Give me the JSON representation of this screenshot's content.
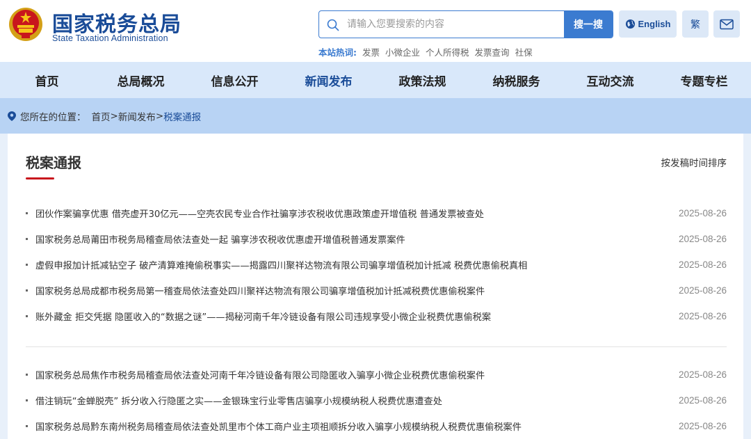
{
  "header": {
    "site_name_cn": "国家税务总局",
    "site_name_en": "State Taxation Administration",
    "search": {
      "placeholder": "请输入您要搜索的内容",
      "button_label": "搜一搜"
    },
    "english_label": "English",
    "traditional_label": "繁",
    "hot_search": {
      "label": "本站热词:",
      "terms": [
        "发票",
        "小微企业",
        "个人所得税",
        "发票查询",
        "社保"
      ]
    }
  },
  "nav": {
    "items": [
      "首页",
      "总局概况",
      "信息公开",
      "新闻发布",
      "政策法规",
      "纳税服务",
      "互动交流",
      "专题专栏"
    ],
    "active": "新闻发布"
  },
  "breadcrumb": {
    "prefix": "您所在的位置：",
    "home": "首页",
    "sep1": ">",
    "parent": "新闻发布",
    "sep2": ">",
    "current": "税案通报"
  },
  "section": {
    "title": "税案通报",
    "sort_label": "按发稿时间排序"
  },
  "news_group1": [
    {
      "title": "团伙作案骗享优惠 借壳虚开30亿元——空壳农民专业合作社骗享涉农税收优惠政策虚开增值税 普通发票被查处",
      "date": "2025-08-26"
    },
    {
      "title": "国家税务总局莆田市税务局稽查局依法查处一起 骗享涉农税收优惠虚开增值税普通发票案件",
      "date": "2025-08-26"
    },
    {
      "title": "虚假申报加计抵减钻空子 破产清算难掩偷税事实——揭露四川聚祥达物流有限公司骗享增值税加计抵减 税费优惠偷税真相",
      "date": "2025-08-26"
    },
    {
      "title": "国家税务总局成都市税务局第一稽查局依法查处四川聚祥达物流有限公司骗享增值税加计抵减税费优惠偷税案件",
      "date": "2025-08-26"
    },
    {
      "title": "账外藏金 拒交凭据 隐匿收入的“数据之谜”——揭秘河南千年冷链设备有限公司违规享受小微企业税费优惠偷税案",
      "date": "2025-08-26"
    }
  ],
  "news_group2": [
    {
      "title": "国家税务总局焦作市税务局稽查局依法查处河南千年冷链设备有限公司隐匿收入骗享小微企业税费优惠偷税案件",
      "date": "2025-08-26"
    },
    {
      "title": "借注销玩“金蝉脱壳” 拆分收入行隐匿之实——金银珠宝行业零售店骗享小规模纳税人税费优惠遭查处",
      "date": "2025-08-26"
    },
    {
      "title": "国家税务总局黔东南州税务局稽查局依法查处凯里市个体工商户业主项祖顺拆分收入骗享小规模纳税人税费优惠偷税案件",
      "date": "2025-08-26"
    }
  ],
  "colors": {
    "brand_blue": "#1a4c98",
    "accent_blue": "#3b7bd0",
    "title_red": "#c8161d",
    "nav_bg": "#d9e8fa",
    "breadcrumb_bg": "#b8d3f4"
  },
  "icons": {
    "emblem": "national-emblem-icon",
    "search": "search-icon",
    "globe": "globe-icon",
    "mail": "mail-icon",
    "location": "location-pin-icon"
  }
}
